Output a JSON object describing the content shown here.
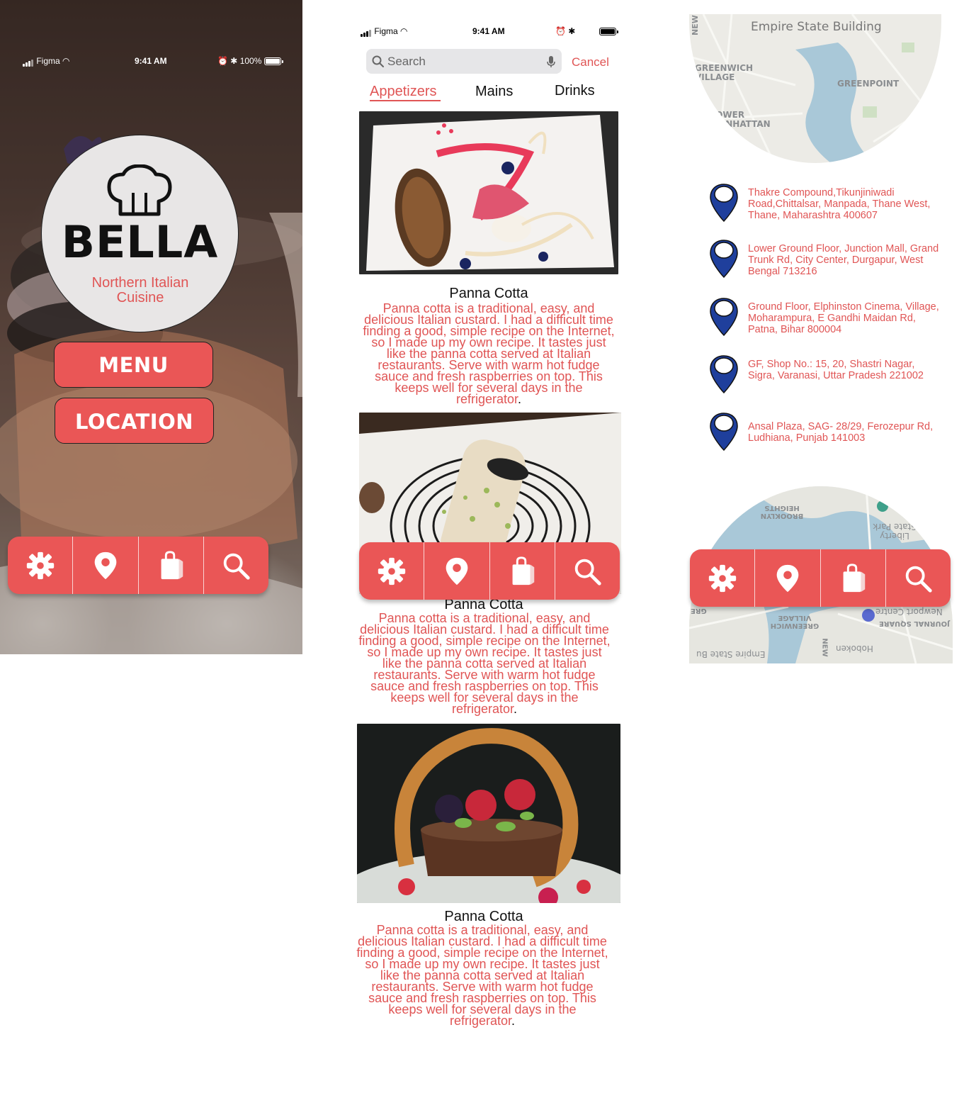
{
  "home": {
    "status": {
      "carrier": "Figma",
      "time": "9:41 AM",
      "battery": "100%"
    },
    "brand_title": "BELLA",
    "brand_subtitle": "Northern Italian Cuisine",
    "menu_button": "MENU",
    "location_button": "LOCATION"
  },
  "tabbar": {
    "accent": "#ea5656",
    "icons": [
      "gear-icon",
      "location-pin-icon",
      "shopping-bag-icon",
      "search-icon"
    ]
  },
  "menu_screen": {
    "status": {
      "carrier": "Figma",
      "time": "9:41 AM"
    },
    "search": {
      "placeholder": "Search",
      "cancel_label": "Cancel"
    },
    "tabs": [
      "Appetizers",
      "Mains",
      "Drinks"
    ],
    "active_tab": "Appetizers",
    "dishes": [
      {
        "name": "Panna Cotta",
        "description": "Panna cotta is a traditional, easy, and delicious Italian custard. I had a difficult time finding a good, simple recipe on the Internet, so I made up my own recipe. It tastes just like the panna cotta served at Italian restaurants. Serve with warm hot fudge sauce and fresh raspberries on top. This keeps well for several days in the refrigerator",
        "end": "."
      },
      {
        "name": "Panna Cotta",
        "description": "Panna cotta is a traditional, easy, and delicious Italian custard. I had a difficult time finding a good, simple recipe on the Internet, so I made up my own recipe. It tastes just like the panna cotta served at Italian restaurants. Serve with warm hot fudge sauce and fresh raspberries on top. This keeps well for several days in the refrigerator",
        "end": "."
      },
      {
        "name": "Panna Cotta",
        "description": "Panna cotta is a traditional, easy, and delicious Italian custard. I had a difficult time finding a good, simple recipe on the Internet, so I made up my own recipe. It tastes just like the panna cotta served at Italian restaurants. Serve with warm hot fudge sauce and fresh raspberries on top. This keeps well for several days in the refrigerator",
        "end": "."
      }
    ]
  },
  "location_screen": {
    "map_top_labels": [
      "Empire State Building",
      "GREENWICH VILLAGE",
      "GREENPOINT",
      "LOWER MANHATTAN",
      "NEW"
    ],
    "map_bottom_labels": [
      "BROOKLYN HEIGHTS",
      "Liberty State Park",
      "Newport Centre",
      "GREENWICH VILLAGE",
      "JOURNAL SQUARE",
      "Empire State Bu",
      "Hoboken",
      "NEW",
      "GRE"
    ],
    "pin_color": "#1f3f9c",
    "locations": [
      "Thakre Compound,Tikunjiniwadi Road,Chittalsar, Manpada, Thane West, Thane, Maharashtra 400607",
      "Lower Ground Floor, Junction Mall, Grand Trunk Rd, City Center, Durgapur, West Bengal 713216",
      "Ground Floor, Elphinston Cinema, Village, Moharampura, E Gandhi Maidan Rd, Patna, Bihar 800004",
      "GF, Shop No.: 15, 20, Shastri Nagar, Sigra, Varanasi, Uttar Pradesh 221002",
      "Ansal Plaza, SAG- 28/29, Ferozepur Rd, Ludhiana, Punjab 141003"
    ]
  }
}
